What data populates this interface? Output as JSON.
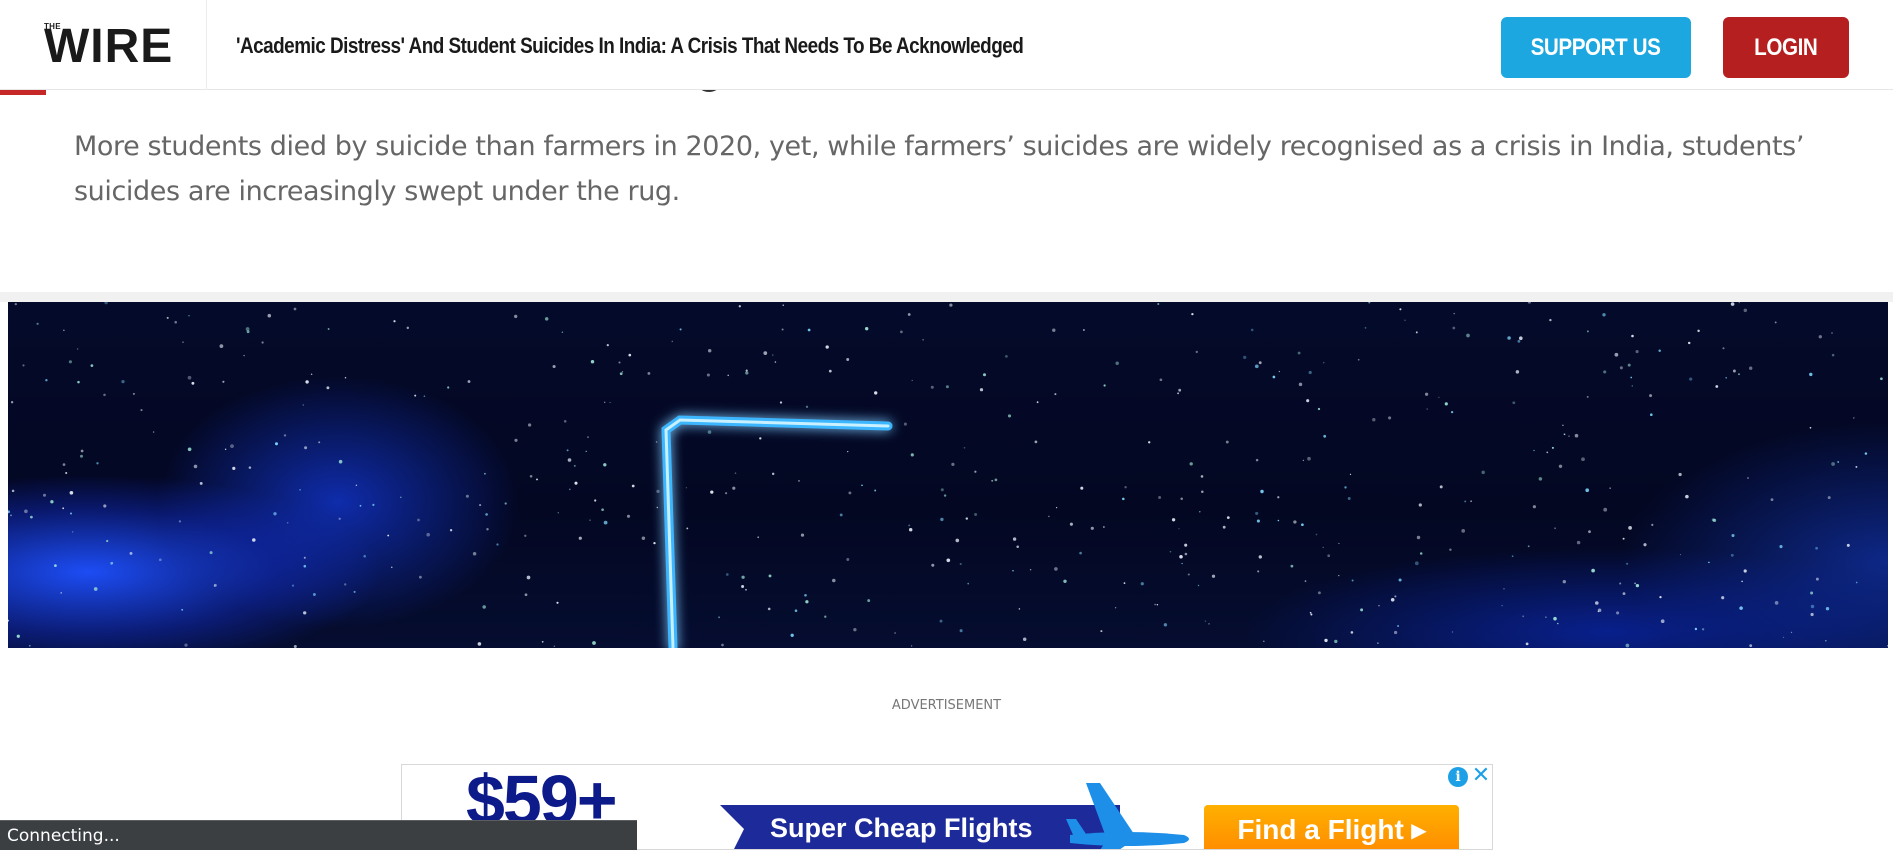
{
  "header": {
    "logo_small": "THE",
    "logo_word": "WIRE",
    "title": "'Academic Distress' And Student Suicides In India: A Crisis That Needs To Be Acknowledged",
    "support_label": "SUPPORT US",
    "login_label": "LOGIN"
  },
  "article": {
    "subtitle": "More students died by suicide than farmers in 2020, yet, while farmers’ suicides are widely recognised as a crisis in India, students’ suicides are increasingly swept under the rug."
  },
  "advertisement": {
    "label": "ADVERTISEMENT",
    "price": "$59+",
    "banner_text": "Super Cheap Flights",
    "cta_label": "Find a Flight ▸",
    "info_icon": "info-icon",
    "close_icon": "close-icon"
  },
  "status": {
    "text": "Connecting..."
  },
  "colors": {
    "support_button": "#1ca7e0",
    "login_button": "#b51f1f",
    "ad_cta": "#ff9a00",
    "ad_navy": "#1d2a9a"
  }
}
